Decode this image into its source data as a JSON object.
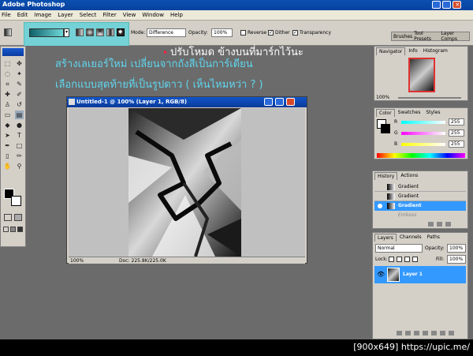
{
  "app": {
    "title": "Adobe Photoshop"
  },
  "menu": [
    "File",
    "Edit",
    "Image",
    "Layer",
    "Select",
    "Filter",
    "View",
    "Window",
    "Help"
  ],
  "options": {
    "mode_label": "Mode:",
    "mode_value": "Difference",
    "opacity_label": "Opacity:",
    "opacity_value": "100%",
    "reverse": "Reverse",
    "dither": "Dither",
    "transparency": "Transparency",
    "well_tabs": [
      "Brushes",
      "Tool Presets",
      "Layer Comps"
    ]
  },
  "annotations": {
    "line1": "สร้างเลเยอร์ใหม่   เปลี่ยนจากถังสีเป็นการ์เดียน",
    "line2": "ปรับโหมด ข้างบนที่มาร์กไว้นะ",
    "line3": "เลือกแบบสุดท้ายที่เป็นรูปดาว ( เห็นไหมหว่า ? )"
  },
  "document": {
    "title": "Untitled-1 @ 100% (Layer 1, RGB/8)",
    "zoom": "100%",
    "doc_info": "Doc: 225.8K/225.0K"
  },
  "navigator": {
    "tabs": [
      "Navigator",
      "Info",
      "Histogram"
    ],
    "zoom": "100%"
  },
  "color": {
    "tabs": [
      "Color",
      "Swatches",
      "Styles"
    ],
    "channels": [
      {
        "label": "R",
        "value": "255",
        "color": "#ff3030"
      },
      {
        "label": "G",
        "value": "255",
        "color": "#30c030"
      },
      {
        "label": "B",
        "value": "255",
        "color": "#3040ff"
      }
    ]
  },
  "history": {
    "tabs": [
      "History",
      "Actions"
    ],
    "items": [
      "Gradient",
      "Gradient",
      "Gradient",
      "Emboss"
    ],
    "selected_index": 2
  },
  "layers": {
    "tabs": [
      "Layers",
      "Channels",
      "Paths"
    ],
    "blend_mode": "Normal",
    "opacity_label": "Opacity:",
    "opacity_value": "100%",
    "lock_label": "Lock:",
    "fill_label": "Fill:",
    "fill_value": "100%",
    "items": [
      {
        "name": "Layer 1"
      }
    ]
  },
  "watermark": "[900x649] https://upic.me/",
  "colors": {
    "accent_highlight": "#74d2d6",
    "annotation_cyan": "#5fd6ef",
    "selection_blue": "#3399ff"
  }
}
